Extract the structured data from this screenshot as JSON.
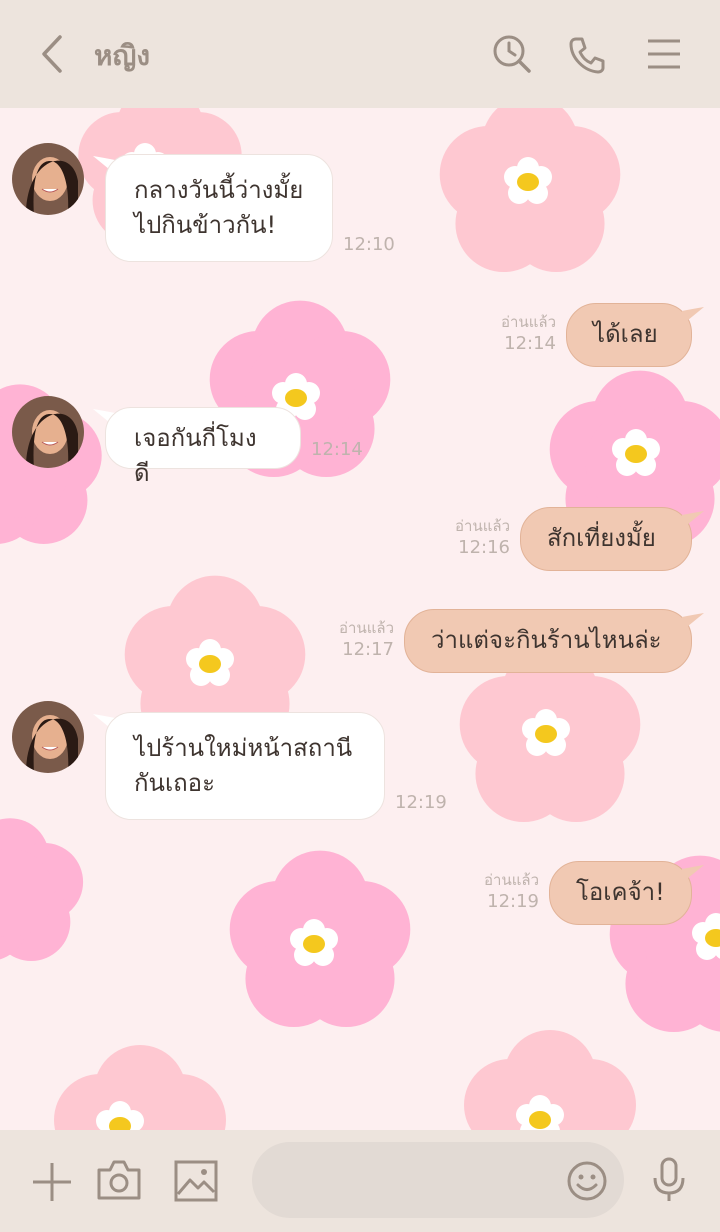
{
  "header": {
    "title": "หญิง",
    "icons": [
      "back-arrow-icon",
      "search-history-icon",
      "phone-icon",
      "menu-icon"
    ]
  },
  "messages": [
    {
      "direction": "in",
      "lines": [
        "กลางวันนี้ว่างมั้ย",
        "ไปกินข้าวกัน!"
      ],
      "time": "12:10"
    },
    {
      "direction": "out",
      "text": "ได้เลย",
      "read": "อ่านแล้ว",
      "time": "12:14"
    },
    {
      "direction": "in",
      "lines": [
        "เจอกันกี่โมงดี"
      ],
      "time": "12:14"
    },
    {
      "direction": "out",
      "text": "สักเที่ยงมั้ย",
      "read": "อ่านแล้ว",
      "time": "12:16"
    },
    {
      "direction": "out",
      "text": "ว่าแต่จะกินร้านไหนล่ะ",
      "read": "อ่านแล้ว",
      "time": "12:17"
    },
    {
      "direction": "in",
      "lines": [
        "ไปร้านใหม่หน้าสถานี",
        "กันเถอะ"
      ],
      "time": "12:19"
    },
    {
      "direction": "out",
      "text": "โอเคจ้า!",
      "read": "อ่านแล้ว",
      "time": "12:19"
    }
  ],
  "footer": {
    "input_value": "",
    "icons": [
      "plus-icon",
      "camera-icon",
      "image-icon",
      "emoji-icon",
      "microphone-icon"
    ]
  },
  "colors": {
    "header_bg": "#ede4dd",
    "chat_bg": "#fdeff0",
    "incoming_bubble": "#ffffff",
    "outgoing_bubble": "#f1c9b3",
    "flower_pink": "#ffb3d4",
    "flower_light_pink": "#fec8d1",
    "flower_center": "#f4c81e"
  }
}
